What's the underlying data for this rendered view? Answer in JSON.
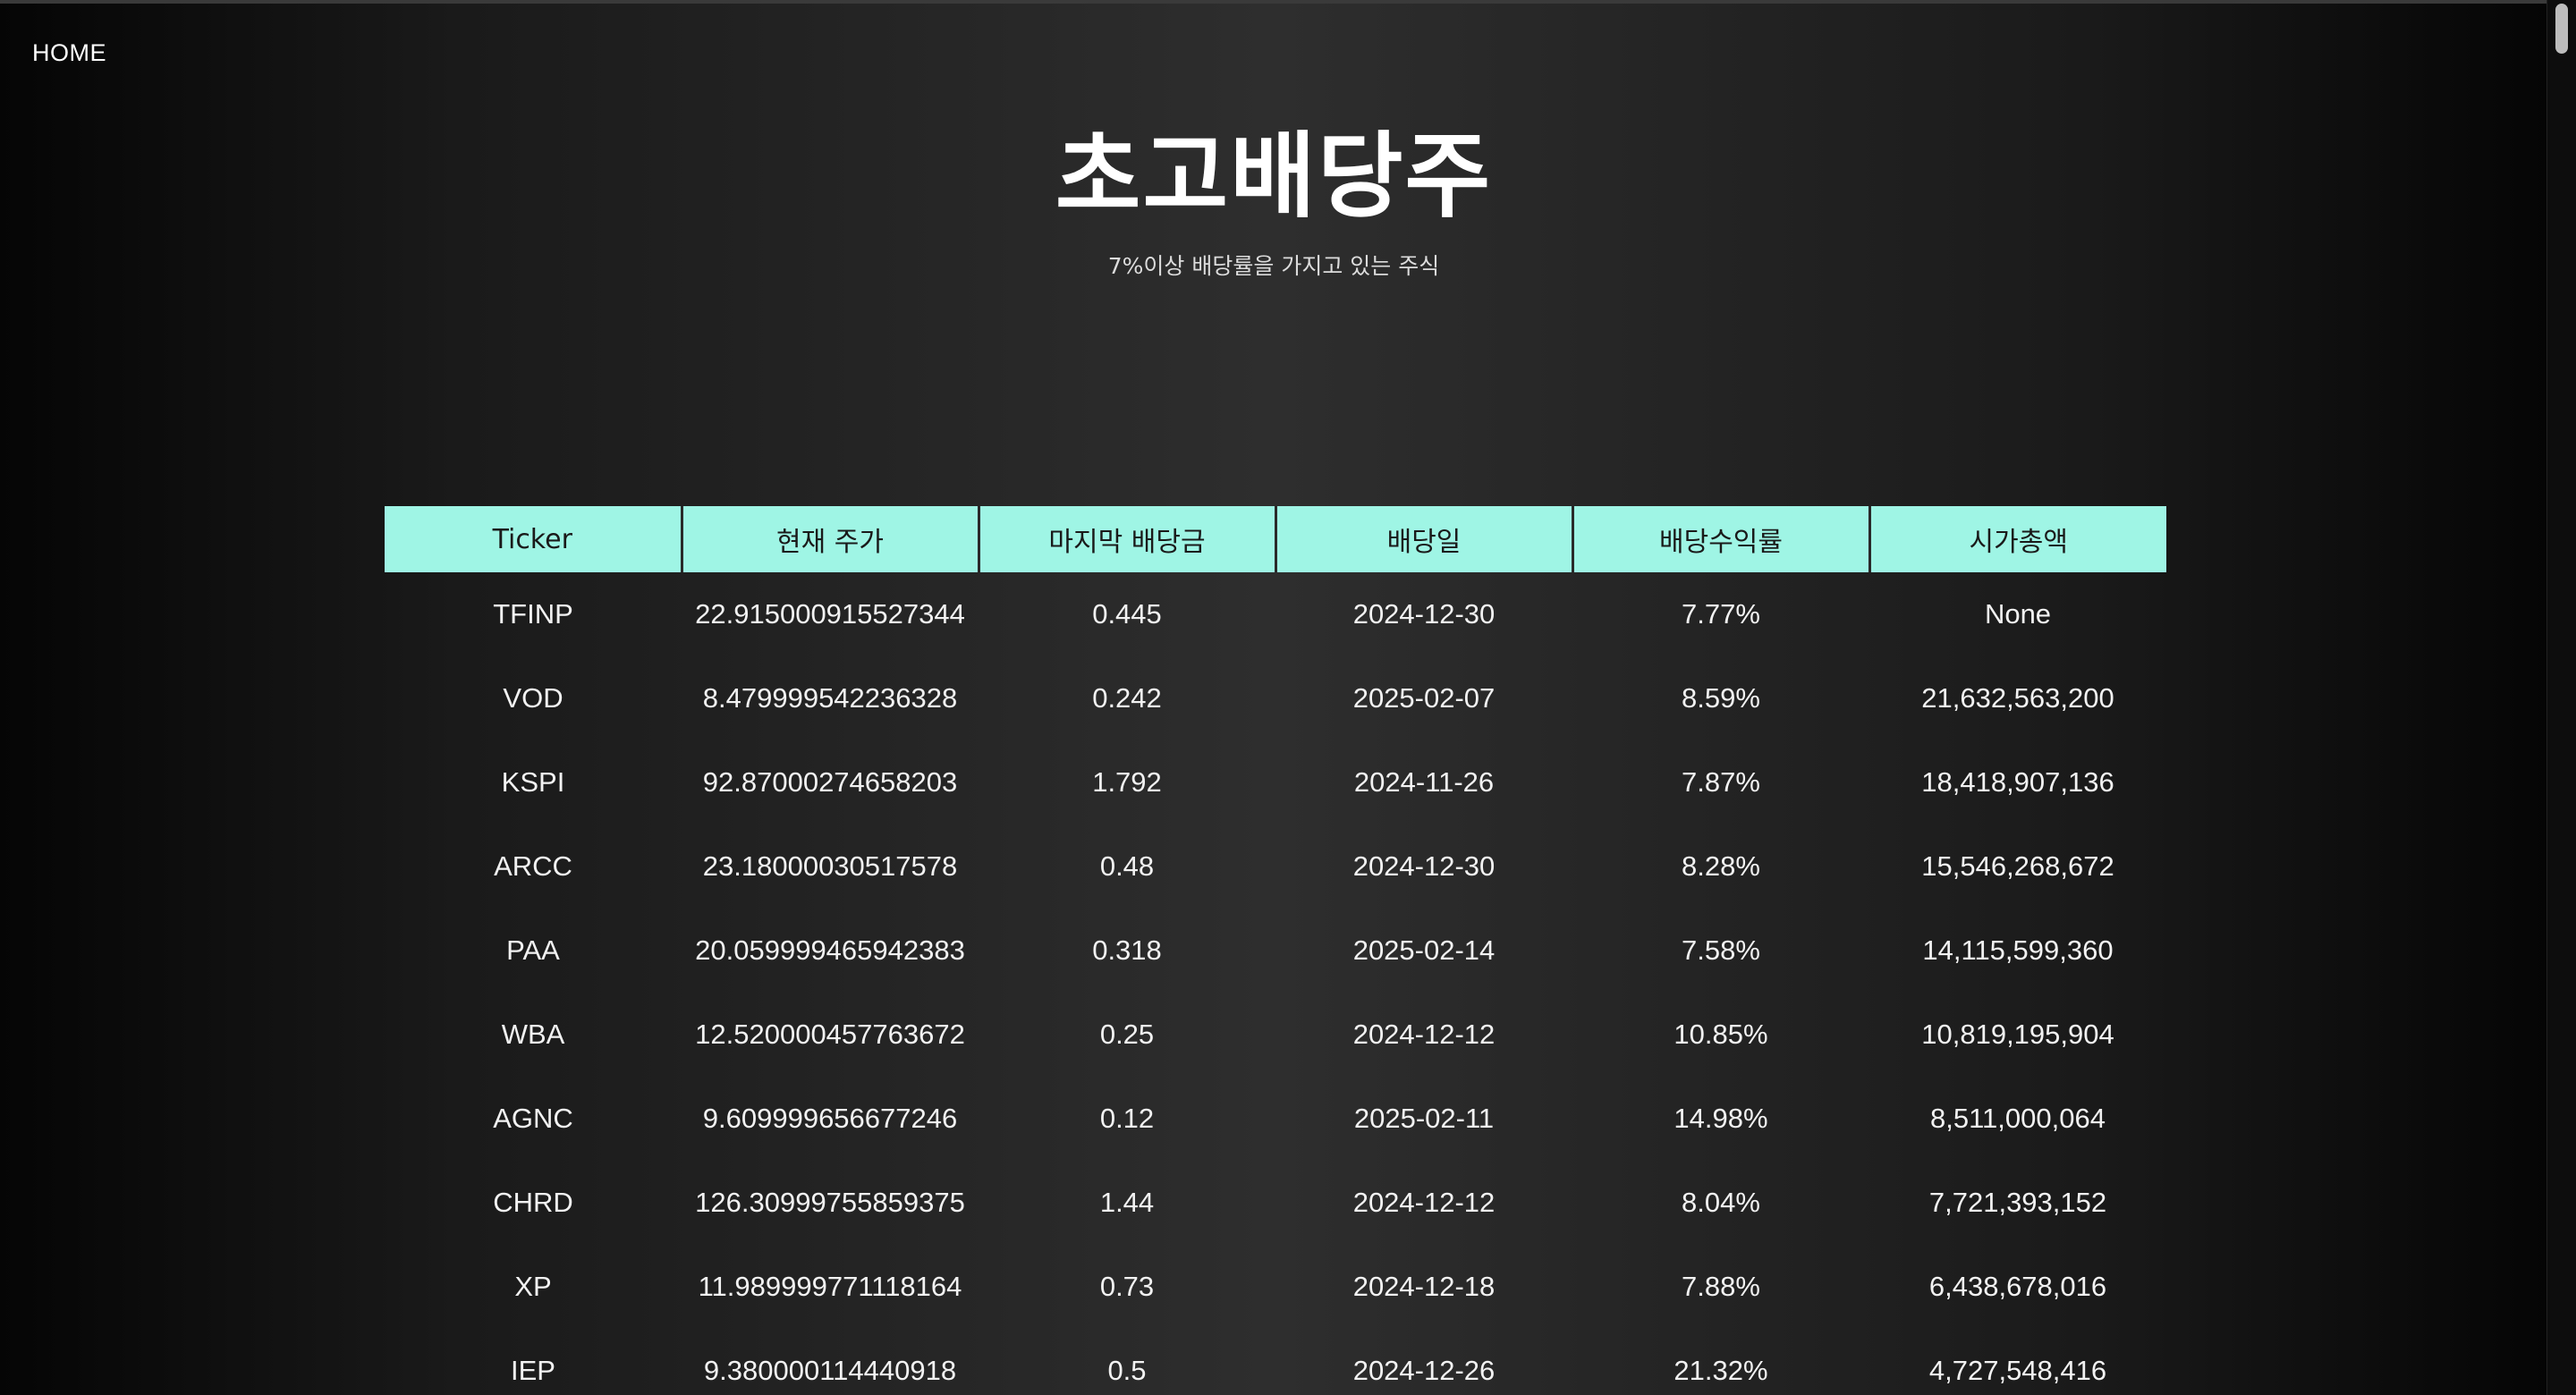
{
  "nav": {
    "home_label": "HOME"
  },
  "header": {
    "title": "초고배당주",
    "subtitle": "7%이상 배당률을 가지고 있는 주식"
  },
  "colors": {
    "header_bg": "#9ff5e5",
    "page_bg_center": "#2e2e2e",
    "page_bg_edge": "#050505"
  },
  "table": {
    "columns": [
      "Ticker",
      "현재 주가",
      "마지막 배당금",
      "배당일",
      "배당수익률",
      "시가총액"
    ],
    "rows": [
      [
        "TFINP",
        "22.915000915527344",
        "0.445",
        "2024-12-30",
        "7.77%",
        "None"
      ],
      [
        "VOD",
        "8.479999542236328",
        "0.242",
        "2025-02-07",
        "8.59%",
        "21,632,563,200"
      ],
      [
        "KSPI",
        "92.87000274658203",
        "1.792",
        "2024-11-26",
        "7.87%",
        "18,418,907,136"
      ],
      [
        "ARCC",
        "23.18000030517578",
        "0.48",
        "2024-12-30",
        "8.28%",
        "15,546,268,672"
      ],
      [
        "PAA",
        "20.059999465942383",
        "0.318",
        "2025-02-14",
        "7.58%",
        "14,115,599,360"
      ],
      [
        "WBA",
        "12.520000457763672",
        "0.25",
        "2024-12-12",
        "10.85%",
        "10,819,195,904"
      ],
      [
        "AGNC",
        "9.609999656677246",
        "0.12",
        "2025-02-11",
        "14.98%",
        "8,511,000,064"
      ],
      [
        "CHRD",
        "126.30999755859375",
        "1.44",
        "2024-12-12",
        "8.04%",
        "7,721,393,152"
      ],
      [
        "XP",
        "11.989999771118164",
        "0.73",
        "2024-12-18",
        "7.88%",
        "6,438,678,016"
      ],
      [
        "IEP",
        "9.380000114440918",
        "0.5",
        "2024-12-26",
        "21.32%",
        "4,727,548,416"
      ]
    ]
  }
}
